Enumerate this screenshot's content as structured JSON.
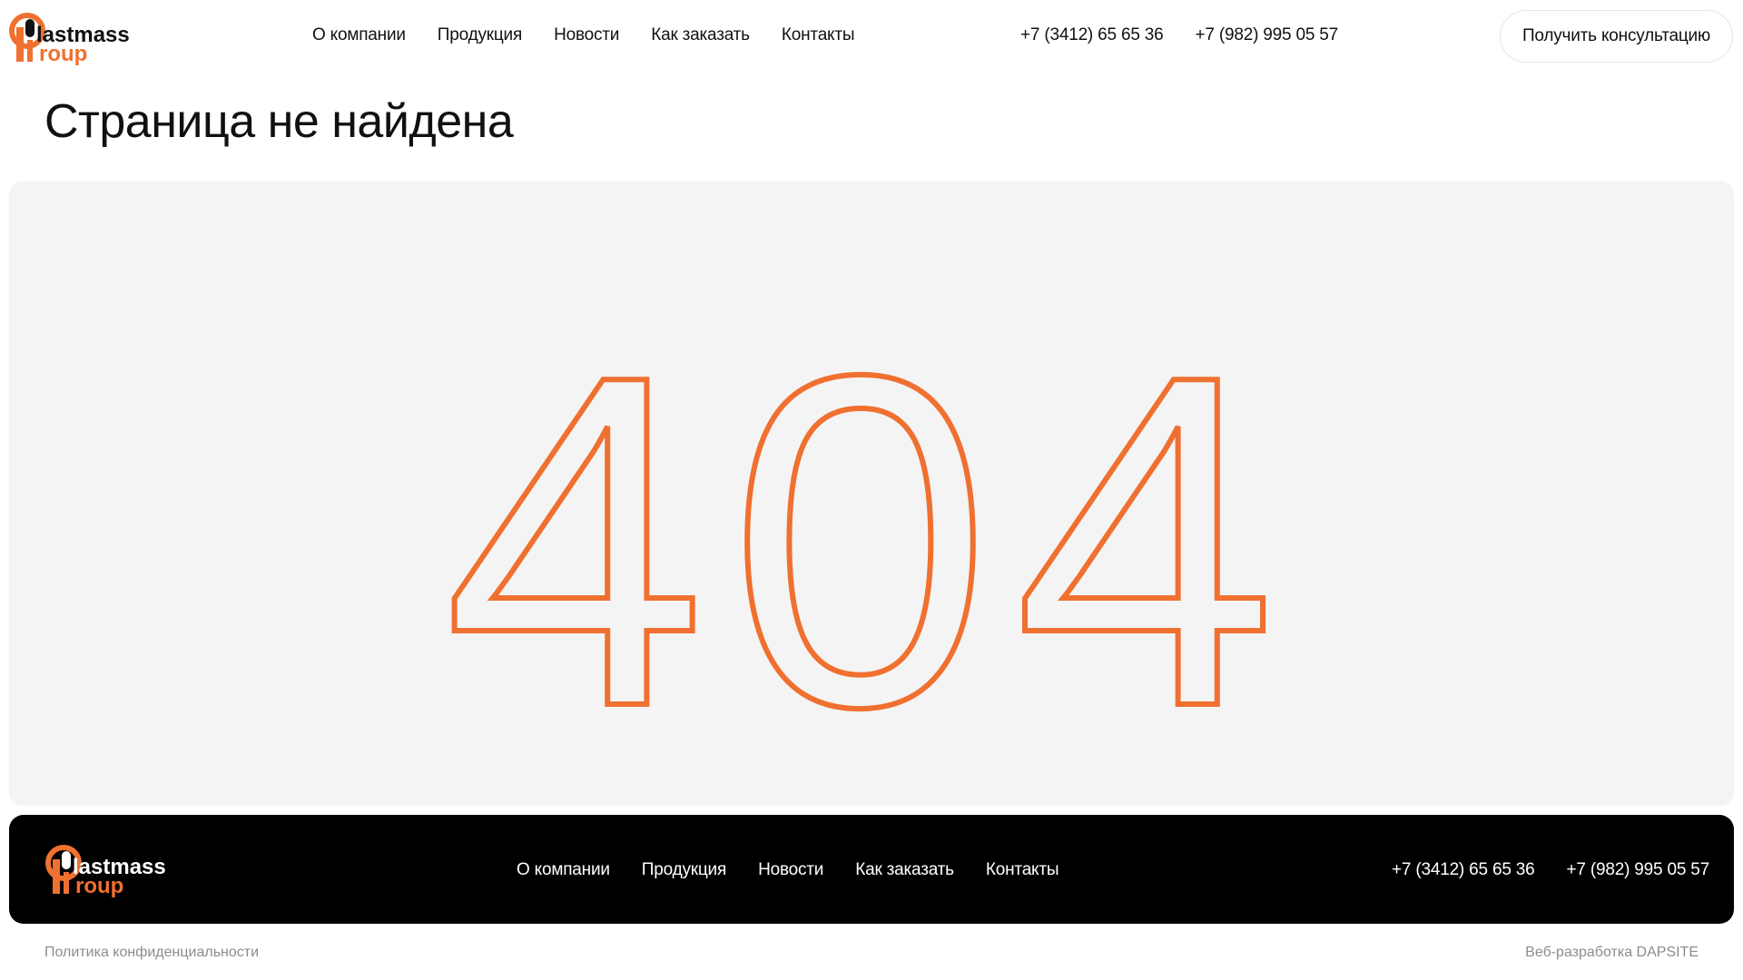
{
  "brand": {
    "logo_word_top": "lastmass",
    "logo_word_bottom": "roup",
    "accent_color": "#f07030"
  },
  "header": {
    "nav": [
      "О компании",
      "Продукция",
      "Новости",
      "Как заказать",
      "Контакты"
    ],
    "phones": [
      "+7 (3412) 65 65 36",
      "+7 (982) 995 05 57"
    ],
    "consult_button": "Получить консультацию"
  },
  "main": {
    "title": "Страница не найдена",
    "error_code": "404"
  },
  "footer": {
    "nav": [
      "О компании",
      "Продукция",
      "Новости",
      "Как заказать",
      "Контакты"
    ],
    "phones": [
      "+7 (3412) 65 65 36",
      "+7 (982) 995 05 57"
    ],
    "privacy": "Политика конфиденциальности",
    "developer": "Веб-разработка DAPSITE"
  }
}
